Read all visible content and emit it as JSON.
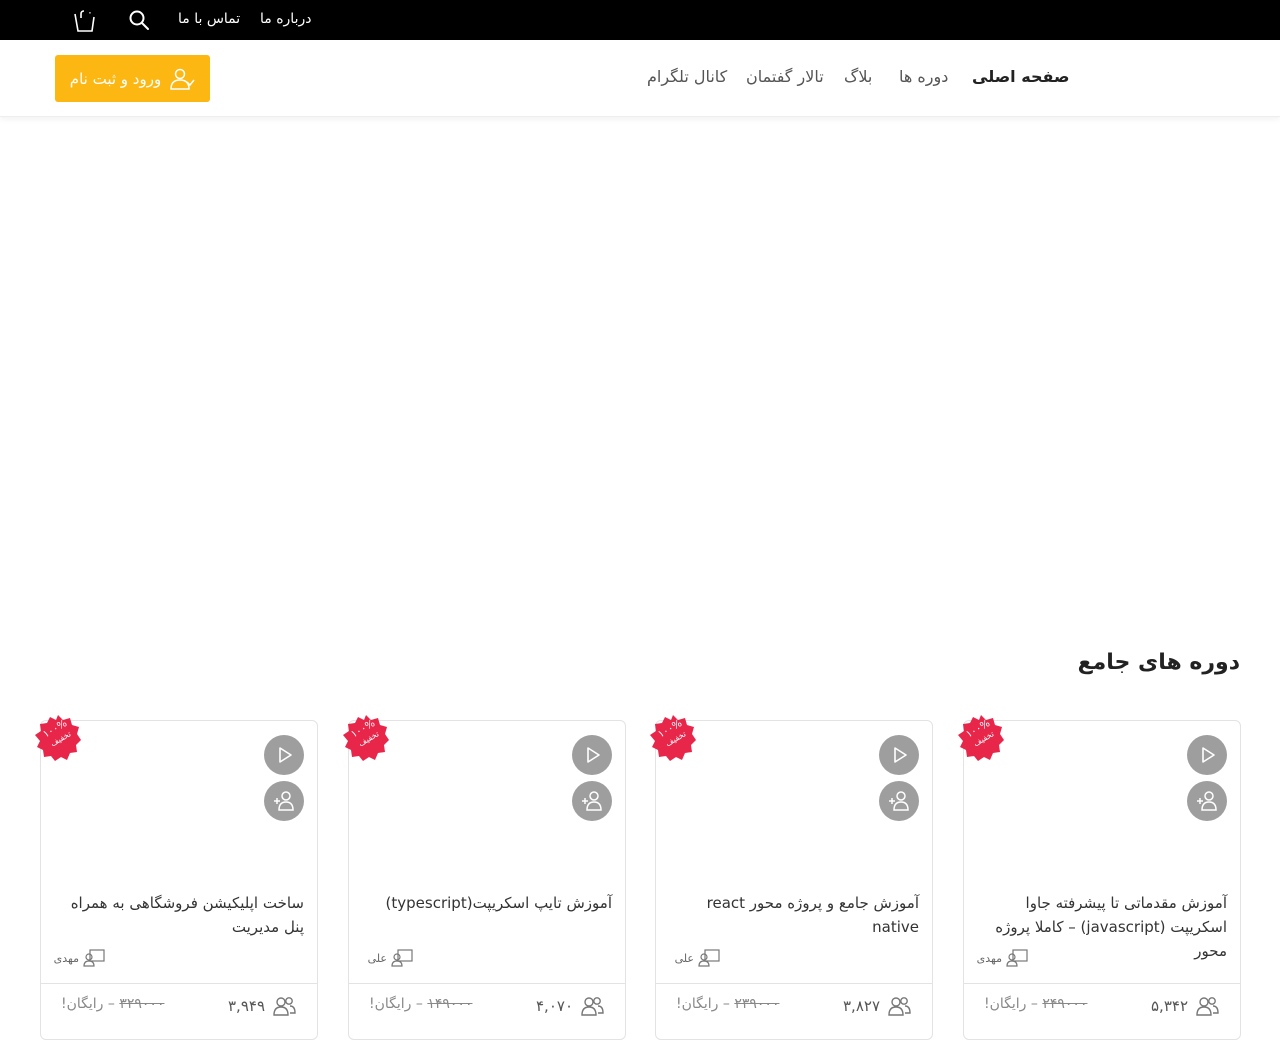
{
  "topbar": {
    "cart_count": "۰",
    "links": {
      "about": "درباره ما",
      "contact": "تماس با ما"
    }
  },
  "header": {
    "login_label": "ورود و ثبت نام",
    "nav": {
      "home": "صفحه اصلی",
      "courses": "دوره ها",
      "blog": "بلاگ",
      "forum": "تالار گفتمان",
      "telegram": "کانال تلگرام"
    }
  },
  "section": {
    "title": "دوره های جامع"
  },
  "courses": [
    {
      "title": "آموزش مقدماتی تا پیشرفته جاوا اسکریپت (javascript) – کاملا پروژه محور",
      "teacher": "مهدی",
      "students": "۵,۳۴۲",
      "old_price": "۲۴۹۰۰۰",
      "free_label": "– رایگان!",
      "badge_percent": "۱۰۰%",
      "badge_label": "تخفیف"
    },
    {
      "title": "آموزش جامع و پروژه محور react native",
      "teacher": "علی",
      "students": "۳,۸۲۷",
      "old_price": "۲۳۹۰۰۰",
      "free_label": "– رایگان!",
      "badge_percent": "۱۰۰%",
      "badge_label": "تخفیف"
    },
    {
      "title": "آموزش تایپ اسکریپت(typescript)",
      "teacher": "علی",
      "students": "۴,۰۷۰",
      "old_price": "۱۴۹۰۰۰",
      "free_label": "– رایگان!",
      "badge_percent": "۱۰۰%",
      "badge_label": "تخفیف"
    },
    {
      "title": "ساخت اپلیکیشن فروشگاهی به همراه پنل مدیریت",
      "teacher": "مهدی",
      "students": "۳,۹۴۹",
      "old_price": "۳۲۹۰۰۰",
      "free_label": "– رایگان!",
      "badge_percent": "۱۰۰%",
      "badge_label": "تخفیف"
    }
  ],
  "colors": {
    "accent": "#fcb712",
    "badge": "#e8264a",
    "topbar": "#000000",
    "button_gray": "#9e9e9e"
  },
  "icons": {
    "cart": "cart-icon",
    "search": "search-icon",
    "login": "user-icon",
    "play": "play-icon",
    "enroll": "user-plus-icon",
    "teacher": "teacher-icon",
    "students": "students-icon"
  }
}
